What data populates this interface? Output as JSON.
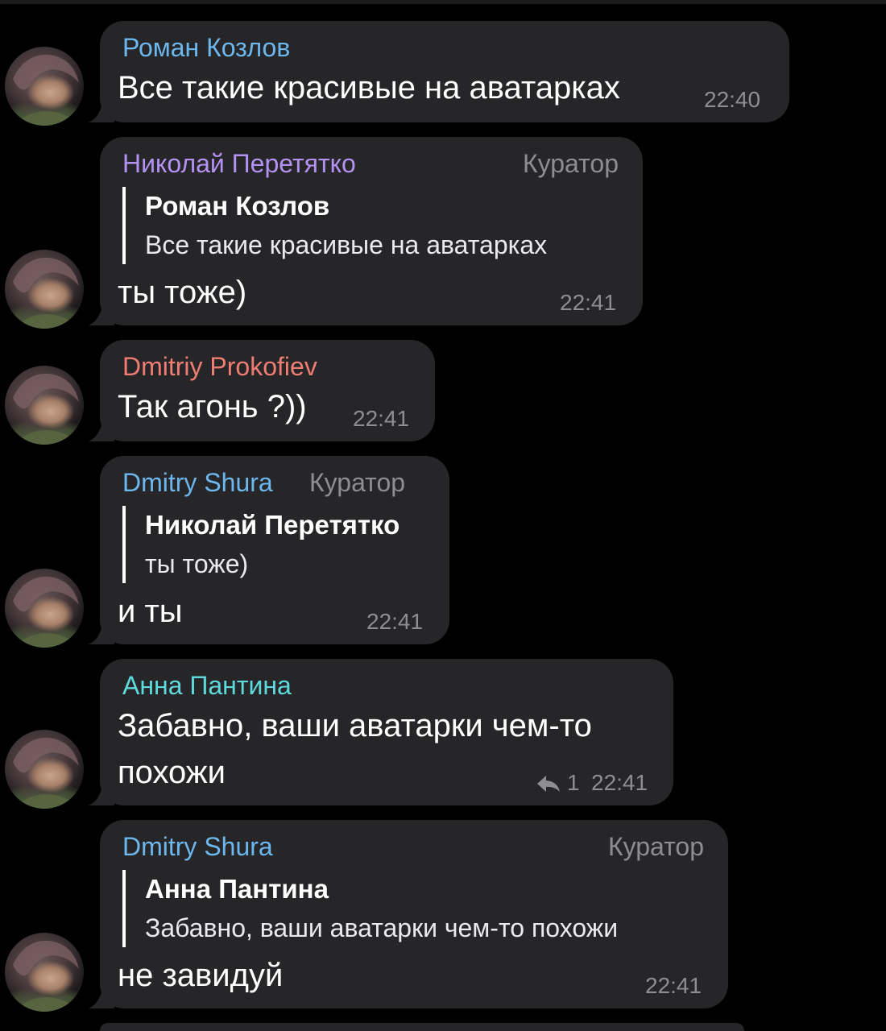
{
  "colors": {
    "background": "#000000",
    "bubble": "#262628",
    "meta": "#8d8d93",
    "name_blue": "#6cb7ee",
    "name_purple": "#b492f4",
    "name_red": "#ef7d72",
    "name_cyan": "#5ed9dc"
  },
  "messages": [
    {
      "sender": "Роман Козлов",
      "text": "Все такие красивые на аватарках",
      "time": "22:40"
    },
    {
      "sender": "Николай Перетятко",
      "role": "Куратор",
      "quote": {
        "name": "Роман Козлов",
        "text": "Все такие красивые на аватарках"
      },
      "text": "ты тоже)",
      "time": "22:41"
    },
    {
      "sender": "Dmitriy Prokofiev",
      "text": "Так агонь ?))",
      "time": "22:41"
    },
    {
      "sender": "Dmitry Shura",
      "role": "Куратор",
      "quote": {
        "name": "Николай Перетятко",
        "text": "ты тоже)"
      },
      "text": "и ты",
      "time": "22:41"
    },
    {
      "sender": "Анна Пантина",
      "text_line1": "Забавно, ваши аватарки чем-то",
      "text_line2": "похожи",
      "reply_icon": "reply-arrow-icon",
      "reply_count": "1",
      "time": "22:41"
    },
    {
      "sender": "Dmitry Shura",
      "role": "Куратор",
      "quote": {
        "name": "Анна Пантина",
        "text": "Забавно, ваши аватарки чем-то похожи"
      },
      "text": "не завидуй",
      "time": "22:41"
    }
  ]
}
